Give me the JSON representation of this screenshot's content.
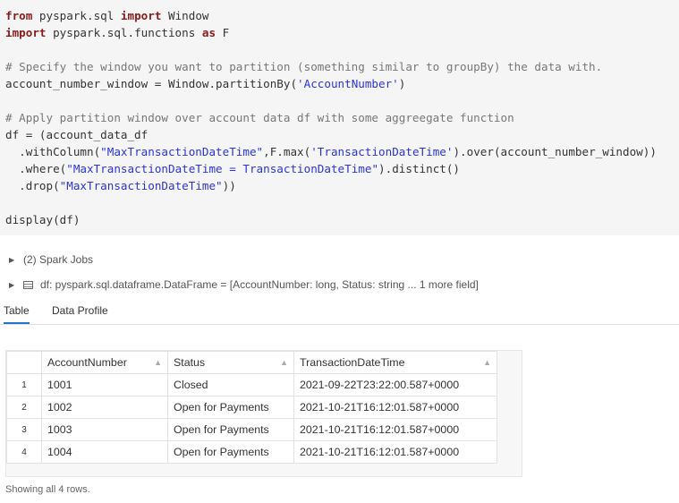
{
  "code_lines": [
    [
      {
        "t": "from",
        "k": "kw"
      },
      {
        "t": " pyspark.sql ",
        "k": ""
      },
      {
        "t": "import",
        "k": "kw"
      },
      {
        "t": " Window",
        "k": ""
      }
    ],
    [
      {
        "t": "import",
        "k": "kw"
      },
      {
        "t": " pyspark.sql.functions ",
        "k": ""
      },
      {
        "t": "as",
        "k": "kw"
      },
      {
        "t": " F",
        "k": ""
      }
    ],
    [],
    [
      {
        "t": "# Specify the window you want to partition (something similar to groupBy) the data with.",
        "k": "cm"
      }
    ],
    [
      {
        "t": "account_number_window = Window.partitionBy(",
        "k": ""
      },
      {
        "t": "'AccountNumber'",
        "k": "str"
      },
      {
        "t": ")",
        "k": ""
      }
    ],
    [],
    [
      {
        "t": "# Apply partition window over account data df with some aggreegate function",
        "k": "cm"
      }
    ],
    [
      {
        "t": "df = (account_data_df",
        "k": ""
      }
    ],
    [
      {
        "t": "  .withColumn(",
        "k": ""
      },
      {
        "t": "\"MaxTransactionDateTime\"",
        "k": "str"
      },
      {
        "t": ",F.max(",
        "k": ""
      },
      {
        "t": "'TransactionDateTime'",
        "k": "str"
      },
      {
        "t": ").over(account_number_window))",
        "k": ""
      }
    ],
    [
      {
        "t": "  .where(",
        "k": ""
      },
      {
        "t": "\"MaxTransactionDateTime = TransactionDateTime\"",
        "k": "str"
      },
      {
        "t": ").distinct()",
        "k": ""
      }
    ],
    [
      {
        "t": "  .drop(",
        "k": ""
      },
      {
        "t": "\"MaxTransactionDateTime\"",
        "k": "str"
      },
      {
        "t": "))",
        "k": ""
      }
    ],
    [],
    [
      {
        "t": "display(df)",
        "k": ""
      }
    ]
  ],
  "spark_jobs": {
    "label": "(2) Spark Jobs"
  },
  "df_info": {
    "text": "df:  pyspark.sql.dataframe.DataFrame = [AccountNumber: long, Status: string ... 1 more field]"
  },
  "tabs": {
    "table": "Table",
    "profile": "Data Profile"
  },
  "table": {
    "columns": [
      "AccountNumber",
      "Status",
      "TransactionDateTime"
    ],
    "rows": [
      {
        "idx": "1",
        "cells": [
          "1001",
          "Closed",
          "2021-09-22T23:22:00.587+0000"
        ]
      },
      {
        "idx": "2",
        "cells": [
          "1002",
          "Open for Payments",
          "2021-10-21T16:12:01.587+0000"
        ]
      },
      {
        "idx": "3",
        "cells": [
          "1003",
          "Open for Payments",
          "2021-10-21T16:12:01.587+0000"
        ]
      },
      {
        "idx": "4",
        "cells": [
          "1004",
          "Open for Payments",
          "2021-10-21T16:12:01.587+0000"
        ]
      }
    ]
  },
  "footer": {
    "text": "Showing all 4 rows."
  },
  "colors": {
    "code_bg": "#f5f5f5",
    "keyword": "#8b1a1a",
    "string": "#2a35d6",
    "comment": "#777777",
    "tab_accent": "#1f77d0"
  }
}
